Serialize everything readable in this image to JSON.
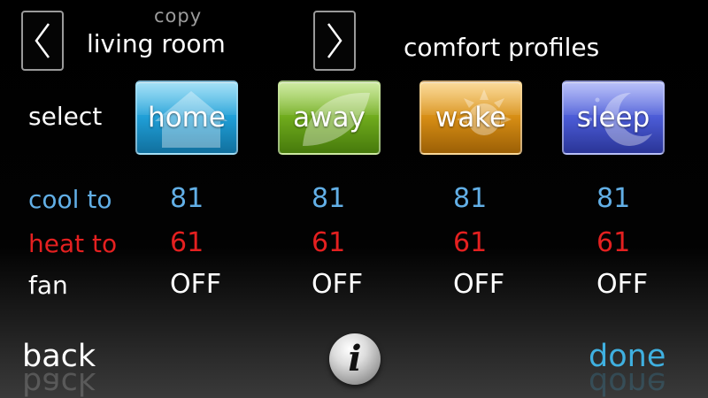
{
  "header": {
    "copy_label": "copy",
    "room_name": "living room",
    "profiles_title": "comfort profiles"
  },
  "select_label": "select",
  "profiles": [
    {
      "id": "home",
      "label": "home",
      "color": "#1f9ed6",
      "icon": "house-icon"
    },
    {
      "id": "away",
      "label": "away",
      "color": "#6faa1c",
      "icon": "leaf-icon"
    },
    {
      "id": "wake",
      "label": "wake",
      "color": "#d68d14",
      "icon": "sun-icon"
    },
    {
      "id": "sleep",
      "label": "sleep",
      "color": "#4b5bd6",
      "icon": "moon-icon"
    }
  ],
  "rows": {
    "cool": {
      "label": "cool to",
      "color": "#62afe6",
      "values": [
        "81",
        "81",
        "81",
        "81"
      ]
    },
    "heat": {
      "label": "heat to",
      "color": "#e42020",
      "values": [
        "61",
        "61",
        "61",
        "61"
      ]
    },
    "fan": {
      "label": "fan",
      "color": "#ffffff",
      "values": [
        "OFF",
        "OFF",
        "OFF",
        "OFF"
      ]
    }
  },
  "footer": {
    "back_label": "back",
    "done_label": "done",
    "info_glyph": "i"
  }
}
